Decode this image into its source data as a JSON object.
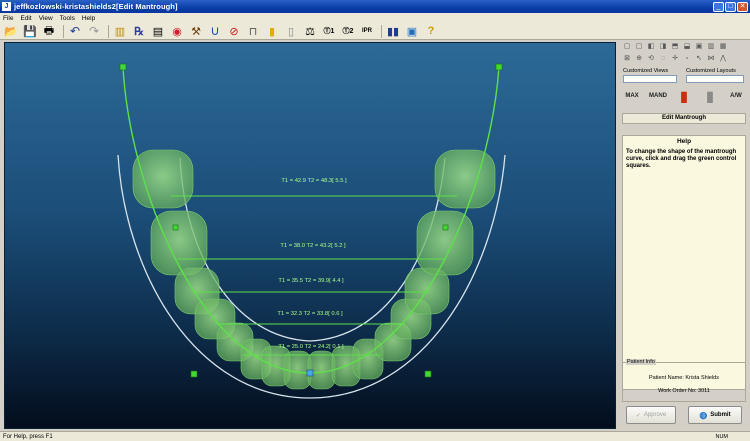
{
  "window": {
    "title": "jeffkozlowski-kristashields2[Edit Mantrough]",
    "app_icon": "app-logo-icon",
    "controls": [
      "minimize",
      "maximize",
      "close"
    ]
  },
  "menu": [
    "File",
    "Edit",
    "View",
    "Tools",
    "Help"
  ],
  "toolbar": {
    "icons": [
      "open-folder-icon",
      "save-icon",
      "print-icon",
      "undo-icon",
      "redo-icon",
      "tooth-chart-icon",
      "prescription-icon",
      "clipboard-icon",
      "lips-icon",
      "hammer-icon",
      "arch-form-icon",
      "red-circle-icon",
      "bracket-icon",
      "tooth-icon",
      "gum-icon",
      "scale-icon",
      "t1-icon",
      "t2-icon",
      "ipr-icon",
      "column-view-icon",
      "image-view-icon",
      "help-icon"
    ]
  },
  "viewport": {
    "measurements": [
      {
        "text": "T1 = 42.9  T2 = 48.3[ 5.5 ]"
      },
      {
        "text": "T1 = 38.0  T2 = 43.2[ 5.2 ]"
      },
      {
        "text": "T1 = 35.5  T2 = 39.9[ 4.4 ]"
      },
      {
        "text": "T1 = 32.3  T2 = 33.8[ 0.6 ]"
      },
      {
        "text": "T1 = 25.0  T2 = 24.2[ 0.1 ]"
      }
    ]
  },
  "panel": {
    "customized_views_label": "Customized Views",
    "customized_layouts_label": "Customized Layouts",
    "big_icons": [
      {
        "name": "max-icon",
        "label": "MAX"
      },
      {
        "name": "mand-icon",
        "label": "MAND"
      },
      {
        "name": "crown-icon",
        "label": ""
      },
      {
        "name": "gray-tooth-icon",
        "label": ""
      },
      {
        "name": "aw-icon",
        "label": "A/W"
      }
    ],
    "edit_header": "Edit Mantrough",
    "help_title": "Help",
    "help_text": "To change the shape of the mantrough curve, click and drag the green control squares.",
    "patient_info_label": "Patient Info",
    "patient_name": "Patient Name: Krista Shields",
    "work_order": "Work Order No: 3011",
    "approve_label": "Approve",
    "submit_label": "Submit"
  },
  "status": {
    "left": "For Help, press F1",
    "num": "NUM"
  }
}
